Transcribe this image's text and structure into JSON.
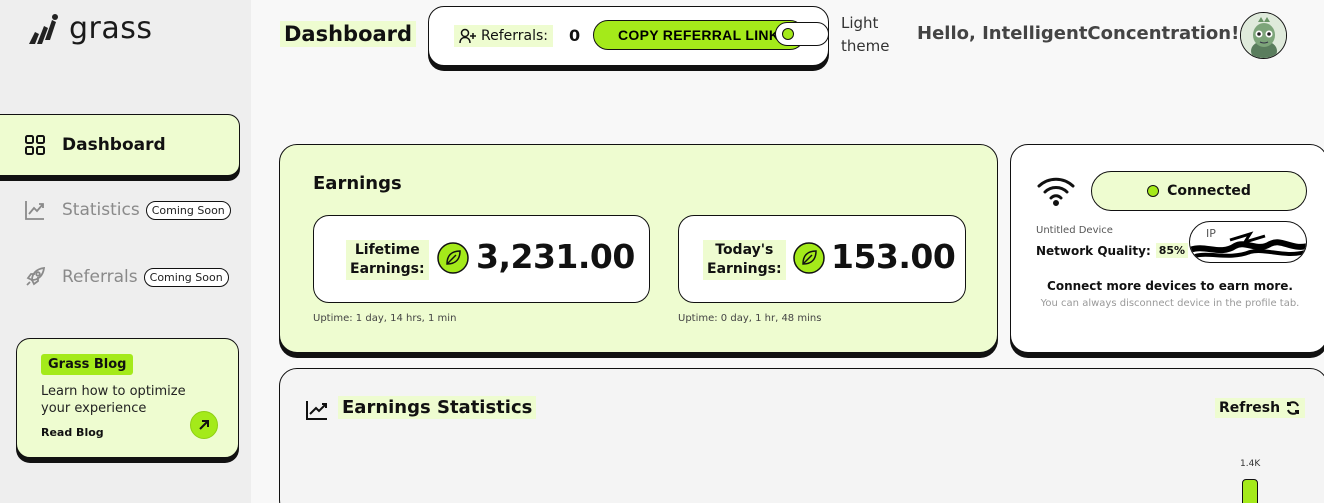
{
  "sidebar": {
    "logo_text": "grass",
    "items": [
      {
        "label": "Dashboard",
        "icon": "grid-icon",
        "active": true
      },
      {
        "label": "Statistics",
        "icon": "chart-line-icon",
        "badge": "Coming Soon"
      },
      {
        "label": "Referrals",
        "icon": "rocket-icon",
        "badge": "Coming Soon"
      }
    ],
    "blog": {
      "tag": "Grass Blog",
      "text": "Learn how to optimize your experience",
      "link": "Read Blog"
    }
  },
  "header": {
    "title": "Dashboard",
    "referrals_label": "Referrals:",
    "referrals_count": "0",
    "copy_button": "COPY REFERRAL LINK",
    "theme_label_1": "Light",
    "theme_label_2": "theme",
    "greeting": "Hello, IntelligentConcentration!"
  },
  "earnings": {
    "title": "Earnings",
    "lifetime_label_1": "Lifetime",
    "lifetime_label_2": "Earnings:",
    "lifetime_value": "3,231.00",
    "lifetime_uptime": "Uptime: 1 day, 14 hrs, 1 min",
    "today_label_1": "Today's",
    "today_label_2": "Earnings:",
    "today_value": "153.00",
    "today_uptime": "Uptime: 0 day, 1 hr, 48 mins"
  },
  "device": {
    "status": "Connected",
    "name": "Untitled Device",
    "network_quality_label": "Network Quality:",
    "network_quality_value": "85%",
    "ip_label": "IP",
    "connect_more": "Connect more devices to earn more.",
    "connect_hint": "You can always disconnect device in the profile tab."
  },
  "stats": {
    "title": "Earnings Statistics",
    "refresh": "Refresh",
    "axis_max": "1.4K"
  },
  "colors": {
    "accent": "#a4ea1a",
    "pale_green": "#eefcd0",
    "border": "#111111"
  }
}
